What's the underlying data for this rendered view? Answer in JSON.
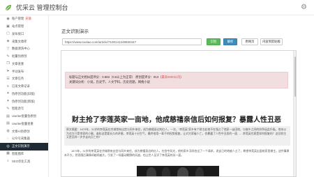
{
  "app": {
    "title": "优采云 管理控制台"
  },
  "icons": {
    "logo": "leaf-logo",
    "settings": "gear-icon"
  },
  "colors": {
    "sidebar_active_bg": "#1e2a36",
    "green_button": "#5cb85c",
    "blue_button": "#3c8dbc",
    "alert_bg": "#f2dede",
    "alert_red": "#d9534f"
  },
  "sidebar": {
    "items": [
      {
        "label": "账户管理",
        "badge": "充值",
        "icon": "user-icon"
      },
      {
        "label": "站点管理",
        "icon": "sitemap-icon"
      },
      {
        "label": "发布接口",
        "icon": "plug-icon"
      },
      {
        "label": "采集文章库",
        "icon": "database-icon"
      },
      {
        "label": "数据清洗中心",
        "icon": "filter-icon"
      },
      {
        "label": "批量伪原创",
        "icon": "edit-icon"
      },
      {
        "label": "文章查重",
        "icon": "copy-icon"
      },
      {
        "label": "手动发布",
        "icon": "send-icon"
      },
      {
        "label": "文章任务",
        "icon": "task-icon"
      },
      {
        "label": "已发文章记录",
        "icon": "list-icon"
      },
      {
        "label": "伪原创功能(旧版)",
        "icon": "magic-icon"
      },
      {
        "label": "伪原创功能(新版)",
        "icon": "magic-icon"
      },
      {
        "label": "智能改写",
        "icon": "pen-icon"
      },
      {
        "label": "Uwriter批量伪原创",
        "icon": "doc-icon"
      },
      {
        "label": "Uwriter批量查重",
        "icon": "doc-icon"
      },
      {
        "label": "文章AI伪原创",
        "icon": "robot-icon"
      },
      {
        "label": "公众号采集器",
        "icon": "wechat-icon"
      },
      {
        "label": "正文识别演示",
        "icon": "eye-icon",
        "active": true
      },
      {
        "label": "智能图库",
        "icon": "image-icon"
      },
      {
        "label": "SEO优化工具",
        "icon": "search-icon"
      }
    ]
  },
  "main": {
    "page_title": "正文识别演示",
    "url_input": {
      "value": "https://www.toutiao.com/article/7100141248930447"
    },
    "buttons": {
      "extract": "识别",
      "parse": "解析",
      "original": "原网页",
      "copy": "内容到剪贴板"
    },
    "alert": {
      "line1_prefix": "标题与正文相似度评分：0.883（0.6以上为正常） 原创度评分：913（",
      "line1_red": "最高5000以内",
      "line1_suffix": "）",
      "line2": "关键词分析：小说，历史学，人文学科，历史话题，网络小说"
    },
    "article": {
      "headline": "财主抢了李莲英家一亩地，他成慈禧亲信后如何报复？暴露人性丑恶",
      "summary": "原文摘要：1879年，31岁的李莲英在京城常有出宫与同乡来往，成为慈禧身边的红人。一次，“李莲英”家乡有个财主趁他不在强占了他家一亩田地，与故乡之间的纷争因此升级。他本以为对方只是李家的小事，谁料这是要长久的矛盾，李莲英十分生气，最终他用一辈子的权势报复，让对方家破人亡，也暴露了人性中丑恶的一面……李莲英究竟是如何报复的？这位财主又是怎样一步步走向灭亡的？",
      "paragraph": "1879年，31岁的李莲英在京城常有出宫与同乡来往，成为慈禧身边的红人，在宫中风光，他的家乡河间也出了一个请求，说自己的地被人占了，希望李莲英出面给家里做主。这件事原本不大，然而随后事情却越闹越大，引发了一场震动朝野的风波，也让世人见识了李莲英的另一面。"
    }
  }
}
